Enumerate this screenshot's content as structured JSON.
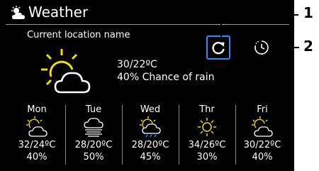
{
  "header": {
    "title": "Weather",
    "icon": "sun-cloud-icon"
  },
  "current": {
    "location_label": "Current location name",
    "temperature": "30/22ºC",
    "rain": "40% Chance of rain",
    "icon": "sun-cloud-icon"
  },
  "buttons": {
    "refresh": "refresh-icon",
    "history": "clock-history-icon"
  },
  "forecast": [
    {
      "day": "Mon",
      "temp": "32/24ºC",
      "rain": "40%",
      "icon": "sun-cloud-icon"
    },
    {
      "day": "Tue",
      "temp": "28/20ºC",
      "rain": "50%",
      "icon": "fog-icon"
    },
    {
      "day": "Wed",
      "temp": "28/20ºC",
      "rain": "45%",
      "icon": "sun-rain-icon"
    },
    {
      "day": "Thr",
      "temp": "34/26ºC",
      "rain": "30%",
      "icon": "sun-icon"
    },
    {
      "day": "Fri",
      "temp": "30/22ºC",
      "rain": "40%",
      "icon": "sun-cloud-icon"
    }
  ],
  "callouts": [
    "1",
    "2"
  ],
  "colors": {
    "background": "#000000",
    "accent": "#2a8cff",
    "sun": "#f0e000",
    "text": "#ffffff"
  }
}
